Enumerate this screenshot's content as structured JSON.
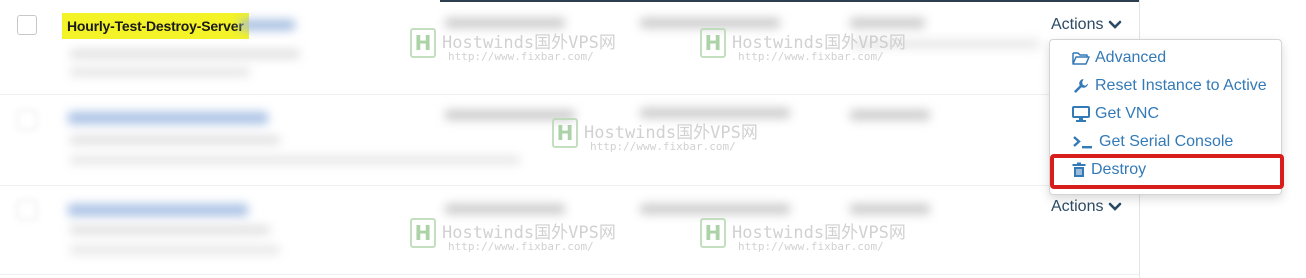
{
  "rows": [
    {
      "server_name": "Hourly-Test-Destroy-Server",
      "actions_label": "Actions"
    },
    {
      "actions_label": "Actions"
    }
  ],
  "actions_menu": {
    "items": [
      {
        "label": "Advanced",
        "icon": "folder-open-icon"
      },
      {
        "label": "Reset Instance to Active",
        "icon": "wrench-icon"
      },
      {
        "label": "Get VNC",
        "icon": "monitor-icon"
      },
      {
        "label": "Get Serial Console",
        "icon": "terminal-icon"
      },
      {
        "label": "Destroy",
        "icon": "trash-icon",
        "highlighted": true
      }
    ]
  },
  "watermark": {
    "title": "Hostwinds国外VPS网",
    "url": "http://www.fixbar.com/",
    "logo_glyph": "H"
  },
  "colors": {
    "highlight_yellow": "#f3f327",
    "link_blue": "#337ab7",
    "actions_text": "#2c4a64",
    "annotation_red": "#d81d1d"
  }
}
